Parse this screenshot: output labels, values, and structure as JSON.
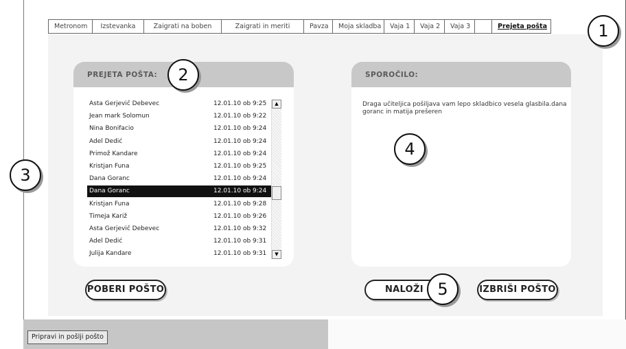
{
  "tabs": [
    "Metronom",
    "Izstevanka",
    "Zaigrati na boben",
    "Zaigrati in meriti",
    "Pavza",
    "Moja skladba",
    "Vaja 1",
    "Vaja 2",
    "Vaja 3"
  ],
  "active_tab": "Prejeta pošta",
  "inbox": {
    "title": "PREJETA POŠTA:",
    "messages": [
      {
        "name": "Asta Gerjevič Debevec",
        "date": "12.01.10 ob 9:25"
      },
      {
        "name": "Jean mark Solomun",
        "date": "12.01.10 ob 9:22"
      },
      {
        "name": "Nina Bonifacio",
        "date": "12.01.10 ob 9:24"
      },
      {
        "name": "Adel Dedić",
        "date": "12.01.10 ob 9:24"
      },
      {
        "name": "Primož Kandare",
        "date": "12.01.10 ob 9:24"
      },
      {
        "name": "Kristjan Funa",
        "date": "12.01.10 ob 9:25"
      },
      {
        "name": "Dana Goranc",
        "date": "12.01.10 ob 9:24"
      },
      {
        "name": "Dana Goranc",
        "date": "12.01.10 ob 9:24",
        "selected": true
      },
      {
        "name": "Kristjan Funa",
        "date": "12.01.10 ob 9:28"
      },
      {
        "name": "Timeja Kariž",
        "date": "12.01.10 ob 9:26"
      },
      {
        "name": "Asta Gerjevič Debevec",
        "date": "12.01.10 ob 9:32"
      },
      {
        "name": "Adel Dedić",
        "date": "12.01.10 ob 9:31"
      },
      {
        "name": "Julija Kandare",
        "date": "12.01.10 ob 9:31"
      }
    ]
  },
  "message_panel": {
    "title": "SPOROČILO:",
    "body": "Draga učiteljica pošiljava vam lepo skladbico vesela glasbila.dana goranc in matija prešeren"
  },
  "buttons": {
    "fetch": "POBERI POŠTO",
    "load": "NALOŽI",
    "delete": "IZBRIŠI POŠTO",
    "compose": "Pripravi in pošlji pošto"
  },
  "callouts": [
    "1",
    "2",
    "3",
    "4",
    "5"
  ],
  "icons": {
    "scroll_up": "arrow-up-icon",
    "scroll_down": "arrow-down-icon"
  }
}
